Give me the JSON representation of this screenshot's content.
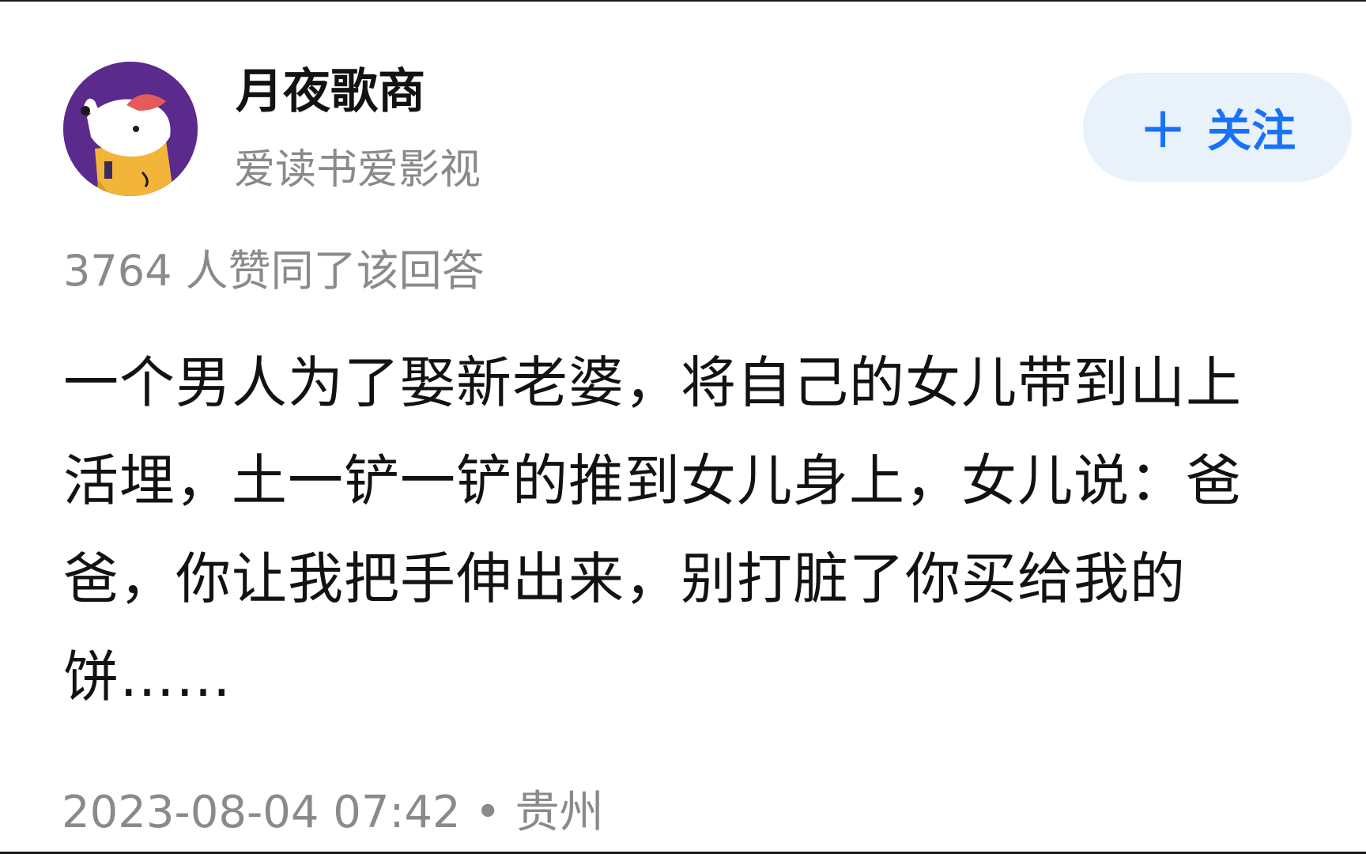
{
  "author": {
    "name": "月夜歌商",
    "bio": "爱读书爱影视",
    "avatar_icon": "dog-character-avatar-icon"
  },
  "follow_button": {
    "icon": "plus-icon",
    "plus_symbol": "+",
    "label": "关注"
  },
  "vote_count_text": "3764 人赞同了该回答",
  "answer": {
    "lines": [
      "一个男人为了娶新老婆，将自己的女儿带到山上",
      "活埋，土一铲一铲的推到女儿身上，女儿说：爸",
      "爸，你让我把手伸出来，别打脏了你买给我的",
      "饼……"
    ]
  },
  "meta": {
    "timestamp": "2023-08-04 07:42",
    "separator": "•",
    "location": "贵州"
  },
  "colors": {
    "accent": "#1772f6",
    "follow_bg": "#e9f1fb",
    "muted_text": "#8a8a8a",
    "body_text": "#121212",
    "avatar_bg": "#5a2a8c"
  }
}
